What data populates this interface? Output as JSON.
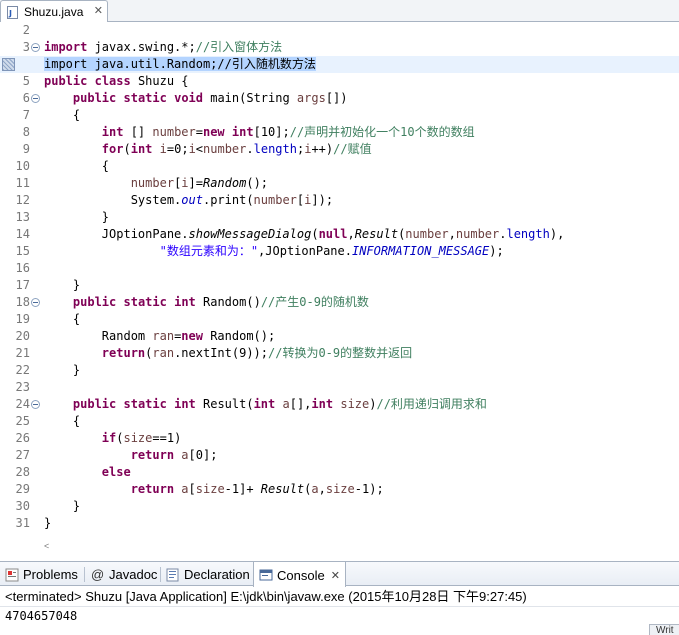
{
  "editor": {
    "tab_label": "Shuzu.java",
    "tab_close": "✕",
    "lines": [
      {
        "num": "2",
        "tokens": []
      },
      {
        "num": "3",
        "fold": true,
        "tokens": [
          {
            "t": "import",
            "c": "kw"
          },
          {
            "t": " javax.swing.*;"
          },
          {
            "t": "//引入窗体方法",
            "c": "cm"
          }
        ]
      },
      {
        "num": "",
        "marker": true,
        "current": true,
        "tokens": [
          {
            "t": "import java.util.Random;//引入随机数方法",
            "c": "sel"
          }
        ]
      },
      {
        "num": "5",
        "tokens": [
          {
            "t": "public",
            "c": "kw"
          },
          {
            "t": " "
          },
          {
            "t": "class",
            "c": "kw"
          },
          {
            "t": " Shuzu {"
          }
        ]
      },
      {
        "num": "6",
        "fold": true,
        "tokens": [
          {
            "t": "    "
          },
          {
            "t": "public",
            "c": "kw"
          },
          {
            "t": " "
          },
          {
            "t": "static",
            "c": "kw"
          },
          {
            "t": " "
          },
          {
            "t": "void",
            "c": "kw"
          },
          {
            "t": " main(String "
          },
          {
            "t": "args",
            "c": "vr"
          },
          {
            "t": "[])"
          }
        ]
      },
      {
        "num": "7",
        "tokens": [
          {
            "t": "    {"
          }
        ]
      },
      {
        "num": "8",
        "tokens": [
          {
            "t": "        "
          },
          {
            "t": "int",
            "c": "kw"
          },
          {
            "t": " [] "
          },
          {
            "t": "number",
            "c": "vr"
          },
          {
            "t": "="
          },
          {
            "t": "new",
            "c": "kw"
          },
          {
            "t": " "
          },
          {
            "t": "int",
            "c": "kw"
          },
          {
            "t": "[10];"
          },
          {
            "t": "//声明并初始化一个10个数的数组",
            "c": "cm"
          }
        ]
      },
      {
        "num": "9",
        "tokens": [
          {
            "t": "        "
          },
          {
            "t": "for",
            "c": "kw"
          },
          {
            "t": "("
          },
          {
            "t": "int",
            "c": "kw"
          },
          {
            "t": " "
          },
          {
            "t": "i",
            "c": "vr"
          },
          {
            "t": "=0;"
          },
          {
            "t": "i",
            "c": "vr"
          },
          {
            "t": "<"
          },
          {
            "t": "number",
            "c": "vr"
          },
          {
            "t": "."
          },
          {
            "t": "length",
            "c": "fi"
          },
          {
            "t": ";"
          },
          {
            "t": "i",
            "c": "vr"
          },
          {
            "t": "++)"
          },
          {
            "t": "//赋值",
            "c": "cm"
          }
        ]
      },
      {
        "num": "10",
        "tokens": [
          {
            "t": "        {"
          }
        ]
      },
      {
        "num": "11",
        "tokens": [
          {
            "t": "            "
          },
          {
            "t": "number",
            "c": "vr"
          },
          {
            "t": "["
          },
          {
            "t": "i",
            "c": "vr"
          },
          {
            "t": "]="
          },
          {
            "t": "Random",
            "c": "it"
          },
          {
            "t": "();"
          }
        ]
      },
      {
        "num": "12",
        "tokens": [
          {
            "t": "            System."
          },
          {
            "t": "out",
            "c": "fd"
          },
          {
            "t": ".print("
          },
          {
            "t": "number",
            "c": "vr"
          },
          {
            "t": "["
          },
          {
            "t": "i",
            "c": "vr"
          },
          {
            "t": "]);"
          }
        ]
      },
      {
        "num": "13",
        "tokens": [
          {
            "t": "        }"
          }
        ]
      },
      {
        "num": "14",
        "tokens": [
          {
            "t": "        JOptionPane."
          },
          {
            "t": "showMessageDialog",
            "c": "it"
          },
          {
            "t": "("
          },
          {
            "t": "null",
            "c": "kw"
          },
          {
            "t": ","
          },
          {
            "t": "Result",
            "c": "it"
          },
          {
            "t": "("
          },
          {
            "t": "number",
            "c": "vr"
          },
          {
            "t": ","
          },
          {
            "t": "number",
            "c": "vr"
          },
          {
            "t": "."
          },
          {
            "t": "length",
            "c": "fi"
          },
          {
            "t": "),"
          }
        ]
      },
      {
        "num": "15",
        "tokens": [
          {
            "t": "                "
          },
          {
            "t": "\"数组元素和为：\"",
            "c": "st"
          },
          {
            "t": ",JOptionPane."
          },
          {
            "t": "INFORMATION_MESSAGE",
            "c": "fd"
          },
          {
            "t": ");"
          }
        ]
      },
      {
        "num": "16",
        "tokens": []
      },
      {
        "num": "17",
        "tokens": [
          {
            "t": "    }"
          }
        ]
      },
      {
        "num": "18",
        "fold": true,
        "tokens": [
          {
            "t": "    "
          },
          {
            "t": "public",
            "c": "kw"
          },
          {
            "t": " "
          },
          {
            "t": "static",
            "c": "kw"
          },
          {
            "t": " "
          },
          {
            "t": "int",
            "c": "kw"
          },
          {
            "t": " Random()"
          },
          {
            "t": "//产生0-9的随机数",
            "c": "cm"
          }
        ]
      },
      {
        "num": "19",
        "tokens": [
          {
            "t": "    {"
          }
        ]
      },
      {
        "num": "20",
        "tokens": [
          {
            "t": "        Random "
          },
          {
            "t": "ran",
            "c": "vr"
          },
          {
            "t": "="
          },
          {
            "t": "new",
            "c": "kw"
          },
          {
            "t": " Random();"
          }
        ]
      },
      {
        "num": "21",
        "tokens": [
          {
            "t": "        "
          },
          {
            "t": "return",
            "c": "kw"
          },
          {
            "t": "("
          },
          {
            "t": "ran",
            "c": "vr"
          },
          {
            "t": ".nextInt(9));"
          },
          {
            "t": "//转换为0-9的整数并返回",
            "c": "cm"
          }
        ]
      },
      {
        "num": "22",
        "tokens": [
          {
            "t": "    }"
          }
        ]
      },
      {
        "num": "23",
        "tokens": []
      },
      {
        "num": "24",
        "fold": true,
        "tokens": [
          {
            "t": "    "
          },
          {
            "t": "public",
            "c": "kw"
          },
          {
            "t": " "
          },
          {
            "t": "static",
            "c": "kw"
          },
          {
            "t": " "
          },
          {
            "t": "int",
            "c": "kw"
          },
          {
            "t": " Result("
          },
          {
            "t": "int",
            "c": "kw"
          },
          {
            "t": " "
          },
          {
            "t": "a",
            "c": "vr"
          },
          {
            "t": "[],"
          },
          {
            "t": "int",
            "c": "kw"
          },
          {
            "t": " "
          },
          {
            "t": "size",
            "c": "vr"
          },
          {
            "t": ")"
          },
          {
            "t": "//利用递归调用求和",
            "c": "cm"
          }
        ]
      },
      {
        "num": "25",
        "tokens": [
          {
            "t": "    {"
          }
        ]
      },
      {
        "num": "26",
        "tokens": [
          {
            "t": "        "
          },
          {
            "t": "if",
            "c": "kw"
          },
          {
            "t": "("
          },
          {
            "t": "size",
            "c": "vr"
          },
          {
            "t": "==1)"
          }
        ]
      },
      {
        "num": "27",
        "tokens": [
          {
            "t": "            "
          },
          {
            "t": "return",
            "c": "kw"
          },
          {
            "t": " "
          },
          {
            "t": "a",
            "c": "vr"
          },
          {
            "t": "[0];"
          }
        ]
      },
      {
        "num": "28",
        "tokens": [
          {
            "t": "        "
          },
          {
            "t": "else",
            "c": "kw"
          }
        ]
      },
      {
        "num": "29",
        "tokens": [
          {
            "t": "            "
          },
          {
            "t": "return",
            "c": "kw"
          },
          {
            "t": " "
          },
          {
            "t": "a",
            "c": "vr"
          },
          {
            "t": "["
          },
          {
            "t": "size",
            "c": "vr"
          },
          {
            "t": "-1]+ "
          },
          {
            "t": "Result",
            "c": "it"
          },
          {
            "t": "("
          },
          {
            "t": "a",
            "c": "vr"
          },
          {
            "t": ","
          },
          {
            "t": "size",
            "c": "vr"
          },
          {
            "t": "-1);"
          }
        ]
      },
      {
        "num": "30",
        "tokens": [
          {
            "t": "    }"
          }
        ]
      },
      {
        "num": "31",
        "tokens": [
          {
            "t": "}"
          }
        ]
      }
    ]
  },
  "views": {
    "tabs": [
      {
        "label": "Problems",
        "icon": "problems-icon"
      },
      {
        "label": "Javadoc",
        "icon": "javadoc-icon"
      },
      {
        "label": "Declaration",
        "icon": "declaration-icon"
      },
      {
        "label": "Console",
        "icon": "console-icon",
        "active": true,
        "close": "✕"
      }
    ]
  },
  "console": {
    "header": "<terminated> Shuzu [Java Application] E:\\jdk\\bin\\javaw.exe (2015年10月28日 下午9:27:45)",
    "output": "4704657048"
  },
  "statusbar": {
    "stub": "Writ"
  },
  "colors": {
    "keyword": "#7f0055",
    "comment": "#3f7f5f",
    "string": "#2a00ff",
    "field": "#0000c0",
    "selection": "#b4d4ff",
    "current_line": "#e8f2fe"
  }
}
